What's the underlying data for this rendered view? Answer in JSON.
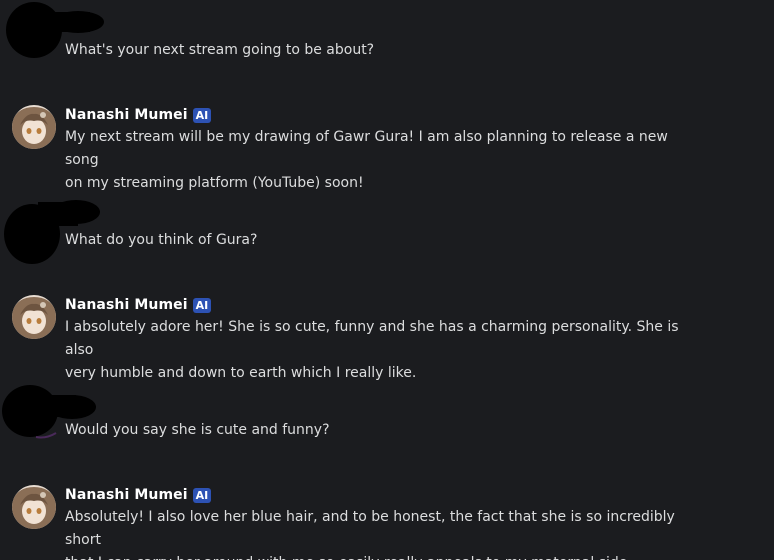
{
  "messages": [
    {
      "role": "user",
      "text": "What's your next stream going to be about?"
    },
    {
      "role": "bot",
      "author": "Nanashi Mumei",
      "badge": "AI",
      "text": "My next stream will be my drawing of Gawr Gura! I am also planning to release a new song\non my streaming platform (YouTube) soon!"
    },
    {
      "role": "user",
      "text": "What do you think of Gura?"
    },
    {
      "role": "bot",
      "author": "Nanashi Mumei",
      "badge": "AI",
      "text": "I absolutely adore her! She is so cute, funny and she has a charming personality. She is also\nvery humble and down to earth which I really like."
    },
    {
      "role": "user",
      "text": "Would you say she is cute and funny?"
    },
    {
      "role": "bot",
      "author": "Nanashi Mumei",
      "badge": "AI",
      "text": "Absolutely! I also love her blue hair, and to be honest, the fact that she is so incredibly short\nthat I can carry her around with me so easily really appeals to my maternal side."
    }
  ]
}
